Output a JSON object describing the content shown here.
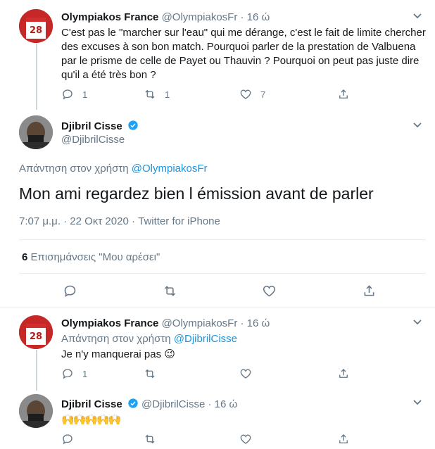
{
  "tweet1": {
    "name": "Olympiakos France",
    "handle": "@OlympiakosFr",
    "time": "· 16 ώ",
    "text": "C'est pas le \"marcher sur l'eau\" qui me dérange, c'est le fait de limite chercher des excuses à son bon match. Pourquoi parler de la prestation de Valbuena par le prisme de celle de Payet ou Thauvin ? Pourquoi on peut pas juste dire qu'il a été très bon ?",
    "replies": "1",
    "retweets": "1",
    "likes": "7"
  },
  "main": {
    "name": "Djibril Cisse",
    "handle": "@DjibrilCisse",
    "reply_prefix": "Απάντηση στον χρήστη",
    "reply_to": "@OlympiakosFr",
    "text": "Mon ami regardez bien l émission avant de parler",
    "timestamp": "7:07 μ.μ. · 22 Οκτ 2020 · Twitter for iPhone",
    "likes_count": "6",
    "likes_label": "Επισημάνσεις \"Μου αρέσει\""
  },
  "tweet3": {
    "name": "Olympiakos France",
    "handle": "@OlympiakosFr",
    "time": "· 16 ώ",
    "reply_prefix": "Απάντηση στον χρήστη",
    "reply_to": "@DjibrilCisse",
    "text": "Je n'y manquerai pas",
    "emoji": "😉",
    "replies": "1"
  },
  "tweet4": {
    "name": "Djibril Cisse",
    "handle": "@DjibrilCisse",
    "time": "· 16 ώ",
    "text": "🙌🙌🙌🙌🙌"
  },
  "colors": {
    "link": "#1b95e0",
    "muted": "#657786",
    "divider": "#e6ecf0",
    "verified": "#1da1f2"
  }
}
